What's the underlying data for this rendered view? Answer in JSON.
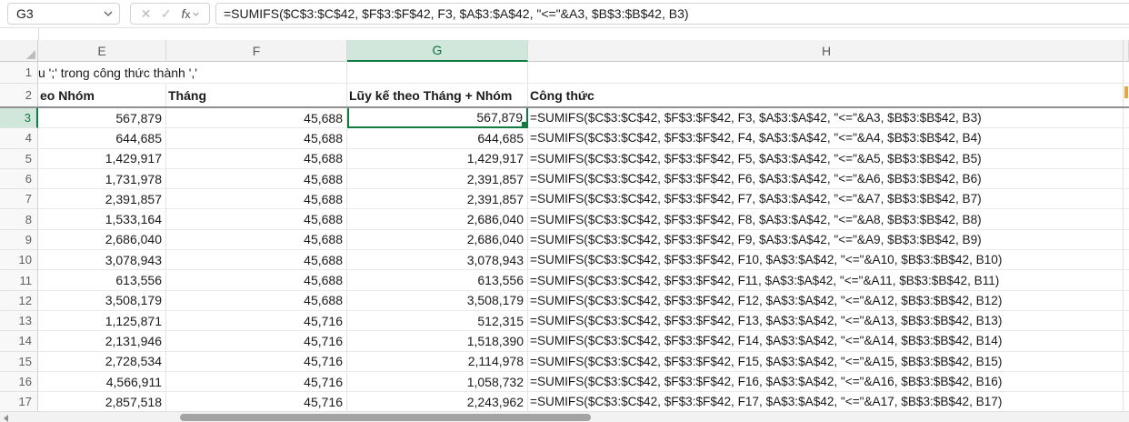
{
  "formula_bar": {
    "name_box_value": "G3",
    "cancel_icon": "✕",
    "enter_icon": "✓",
    "fx_label": "f",
    "fx_label_x": "x",
    "formula": "=SUMIFS($C$3:$C$42, $F$3:$F$42, F3, $A$3:$A$42, \"<=\"&A3, $B$3:$B$42, B3)"
  },
  "grid": {
    "column_letters": {
      "e": "E",
      "f": "F",
      "g": "G",
      "h": "H"
    },
    "selected_column": "G",
    "selected_cell": "G3",
    "selected_row": 3,
    "row1": {
      "num": "1",
      "spill_text": "u ';' trong công thức thành ','"
    },
    "row2": {
      "num": "2",
      "e": "eo Nhóm",
      "f": "Tháng",
      "g": "Lũy kế theo Tháng + Nhóm",
      "h": "Công thức"
    },
    "rows": [
      {
        "num": "3",
        "e": "567,879",
        "f": "45,688",
        "g": "567,879",
        "h": "=SUMIFS($C$3:$C$42, $F$3:$F$42, F3, $A$3:$A$42, \"<=\"&A3, $B$3:$B$42, B3)"
      },
      {
        "num": "4",
        "e": "644,685",
        "f": "45,688",
        "g": "644,685",
        "h": "=SUMIFS($C$3:$C$42, $F$3:$F$42, F4, $A$3:$A$42, \"<=\"&A4, $B$3:$B$42, B4)"
      },
      {
        "num": "5",
        "e": "1,429,917",
        "f": "45,688",
        "g": "1,429,917",
        "h": "=SUMIFS($C$3:$C$42, $F$3:$F$42, F5, $A$3:$A$42, \"<=\"&A5, $B$3:$B$42, B5)"
      },
      {
        "num": "6",
        "e": "1,731,978",
        "f": "45,688",
        "g": "2,391,857",
        "h": "=SUMIFS($C$3:$C$42, $F$3:$F$42, F6, $A$3:$A$42, \"<=\"&A6, $B$3:$B$42, B6)"
      },
      {
        "num": "7",
        "e": "2,391,857",
        "f": "45,688",
        "g": "2,391,857",
        "h": "=SUMIFS($C$3:$C$42, $F$3:$F$42, F7, $A$3:$A$42, \"<=\"&A7, $B$3:$B$42, B7)"
      },
      {
        "num": "8",
        "e": "1,533,164",
        "f": "45,688",
        "g": "2,686,040",
        "h": "=SUMIFS($C$3:$C$42, $F$3:$F$42, F8, $A$3:$A$42, \"<=\"&A8, $B$3:$B$42, B8)"
      },
      {
        "num": "9",
        "e": "2,686,040",
        "f": "45,688",
        "g": "2,686,040",
        "h": "=SUMIFS($C$3:$C$42, $F$3:$F$42, F9, $A$3:$A$42, \"<=\"&A9, $B$3:$B$42, B9)"
      },
      {
        "num": "10",
        "e": "3,078,943",
        "f": "45,688",
        "g": "3,078,943",
        "h": "=SUMIFS($C$3:$C$42, $F$3:$F$42, F10, $A$3:$A$42, \"<=\"&A10, $B$3:$B$42, B10)"
      },
      {
        "num": "11",
        "e": "613,556",
        "f": "45,688",
        "g": "613,556",
        "h": "=SUMIFS($C$3:$C$42, $F$3:$F$42, F11, $A$3:$A$42, \"<=\"&A11, $B$3:$B$42, B11)"
      },
      {
        "num": "12",
        "e": "3,508,179",
        "f": "45,688",
        "g": "3,508,179",
        "h": "=SUMIFS($C$3:$C$42, $F$3:$F$42, F12, $A$3:$A$42, \"<=\"&A12, $B$3:$B$42, B12)"
      },
      {
        "num": "13",
        "e": "1,125,871",
        "f": "45,716",
        "g": "512,315",
        "h": "=SUMIFS($C$3:$C$42, $F$3:$F$42, F13, $A$3:$A$42, \"<=\"&A13, $B$3:$B$42, B13)"
      },
      {
        "num": "14",
        "e": "2,131,946",
        "f": "45,716",
        "g": "1,518,390",
        "h": "=SUMIFS($C$3:$C$42, $F$3:$F$42, F14, $A$3:$A$42, \"<=\"&A14, $B$3:$B$42, B14)"
      },
      {
        "num": "15",
        "e": "2,728,534",
        "f": "45,716",
        "g": "2,114,978",
        "h": "=SUMIFS($C$3:$C$42, $F$3:$F$42, F15, $A$3:$A$42, \"<=\"&A15, $B$3:$B$42, B15)"
      },
      {
        "num": "16",
        "e": "4,566,911",
        "f": "45,716",
        "g": "1,058,732",
        "h": "=SUMIFS($C$3:$C$42, $F$3:$F$42, F16, $A$3:$A$42, \"<=\"&A16, $B$3:$B$42, B16)"
      },
      {
        "num": "17",
        "e": "2,857,518",
        "f": "45,716",
        "g": "2,243,962",
        "h": "=SUMIFS($C$3:$C$42, $F$3:$F$42, F17, $A$3:$A$42, \"<=\"&A17, $B$3:$B$42, B17)"
      }
    ]
  },
  "colors": {
    "selection_green": "#107C41",
    "selected_header_fill": "#D2E7DB",
    "header_fill": "#F3F3F3",
    "row2_border_gray": "#8F8F8F",
    "clipped_text_orange": "#EBA33C"
  }
}
